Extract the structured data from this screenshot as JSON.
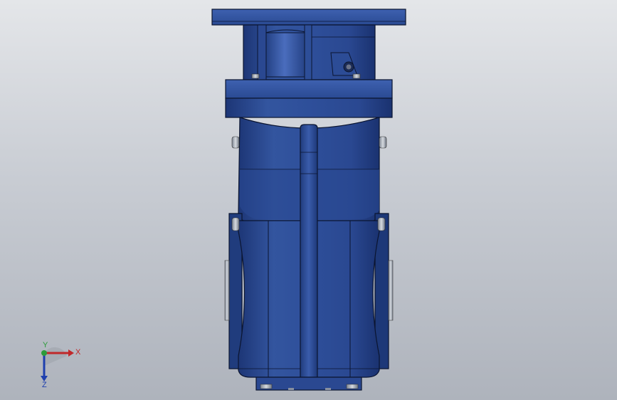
{
  "viewport": {
    "background_top": "#e4e6e9",
    "background_bottom": "#aeb3bc"
  },
  "model": {
    "body_color": "#2e4f9a",
    "body_dark": "#1f3a7a",
    "body_light": "#4466b4",
    "edge_color": "#0b1530"
  },
  "triad": {
    "x_label": "X",
    "y_label": "Y",
    "z_label": "Z",
    "x_color": "#c0282a",
    "y_color": "#2c9c3a",
    "z_color": "#1e3fae"
  }
}
